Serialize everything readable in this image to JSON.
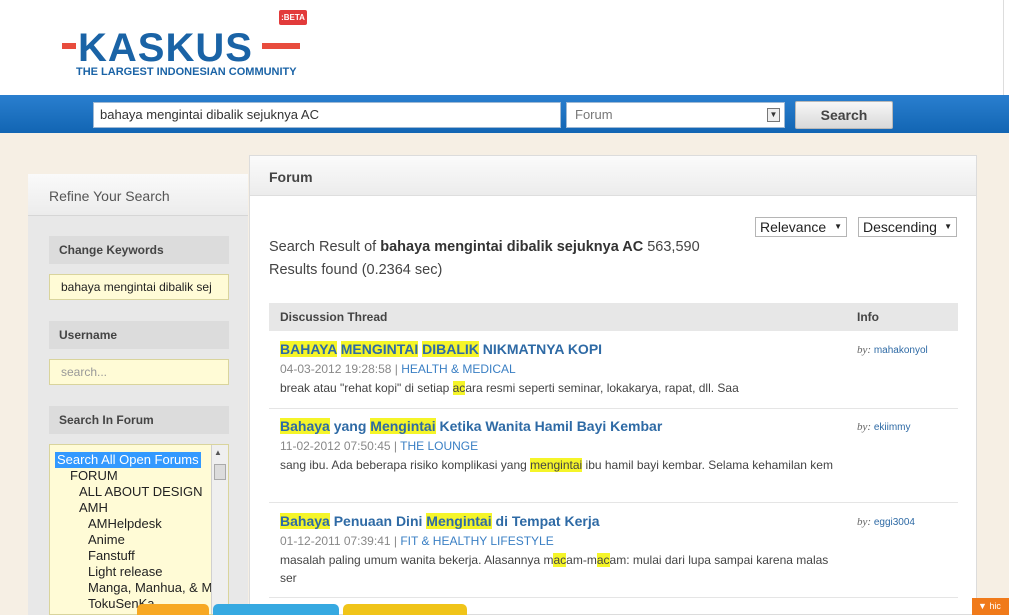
{
  "logo": {
    "word": "KASKUS",
    "beta": ":BETA",
    "tagline": "THE LARGEST INDONESIAN COMMUNITY"
  },
  "searchbar": {
    "keyword_value": "bahaya mengintai dibalik sejuknya AC",
    "scope_value": "Forum",
    "search_label": "Search"
  },
  "sidebar": {
    "title": "Refine Your Search",
    "change_keywords_label": "Change Keywords",
    "keywords_value": "bahaya mengintai dibalik sej",
    "username_label": "Username",
    "username_placeholder": "search...",
    "search_in_forum_label": "Search In Forum",
    "forum_items": [
      "Search All Open Forums",
      "FORUM",
      "ALL ABOUT DESIGN",
      "AMH",
      "AMHelpdesk",
      "Anime",
      "Fanstuff",
      "Light release",
      "Manga, Manhua, & M",
      "TokuSenKa"
    ]
  },
  "main": {
    "title": "Forum",
    "sort_by": "Relevance",
    "sort_order": "Descending",
    "summary_prefix": "Search Result of",
    "summary_query": "bahaya mengintai dibalik sejuknya AC",
    "summary_count": "563,590",
    "summary_time": "Results found (0.2364 sec)",
    "col_thread": "Discussion Thread",
    "col_info": "Info",
    "results": [
      {
        "title_parts": [
          {
            "t": "BAHAYA",
            "hl": true
          },
          {
            "t": " ",
            "hl": false
          },
          {
            "t": "MENGINTAI",
            "hl": true
          },
          {
            "t": " ",
            "hl": false
          },
          {
            "t": "DIBALIK",
            "hl": true
          },
          {
            "t": " NIKMATNYA KOPI",
            "hl": false
          }
        ],
        "date": "04-03-2012 19:28:58",
        "category": "HEALTH & MEDICAL",
        "snippet_parts": [
          {
            "t": "break atau \"rehat kopi\" di setiap ",
            "hl": false
          },
          {
            "t": "ac",
            "hl": true
          },
          {
            "t": "ara resmi seperti seminar, lokakarya, rapat, dll. Saa",
            "hl": false
          }
        ],
        "by_label": "by:",
        "author": "mahakonyol"
      },
      {
        "title_parts": [
          {
            "t": "Bahaya",
            "hl": true
          },
          {
            "t": " yang ",
            "hl": false
          },
          {
            "t": "Mengintai",
            "hl": true
          },
          {
            "t": " Ketika Wanita Hamil Bayi Kembar",
            "hl": false
          }
        ],
        "date": "11-02-2012 07:50:45",
        "category": "THE LOUNGE",
        "snippet_parts": [
          {
            "t": "sang ibu. Ada beberapa risiko komplikasi yang ",
            "hl": false
          },
          {
            "t": "mengintai",
            "hl": true
          },
          {
            "t": " ibu hamil bayi kembar. Selama kehamilan kem",
            "hl": false
          }
        ],
        "by_label": "by:",
        "author": "ekiimmy"
      },
      {
        "title_parts": [
          {
            "t": "Bahaya",
            "hl": true
          },
          {
            "t": " Penuaan Dini ",
            "hl": false
          },
          {
            "t": "Mengintai",
            "hl": true
          },
          {
            "t": " di Tempat Kerja",
            "hl": false
          }
        ],
        "date": "01-12-2011 07:39:41",
        "category": "FIT & HEALTHY LIFESTYLE",
        "snippet_parts": [
          {
            "t": "masalah paling umum wanita bekerja. Alasannya m",
            "hl": false
          },
          {
            "t": "ac",
            "hl": true
          },
          {
            "t": "am-m",
            "hl": false
          },
          {
            "t": "ac",
            "hl": true
          },
          {
            "t": "am: mulai dari lupa sampai karena malas ser",
            "hl": false
          }
        ],
        "by_label": "by:",
        "author": "eggi3004"
      }
    ]
  },
  "corner_button": "▼ hic",
  "colors": {
    "brand_blue": "#1a63a6",
    "bar_blue": "#1f72c2",
    "highlight": "#f5f529",
    "link": "#2e6aa5"
  }
}
